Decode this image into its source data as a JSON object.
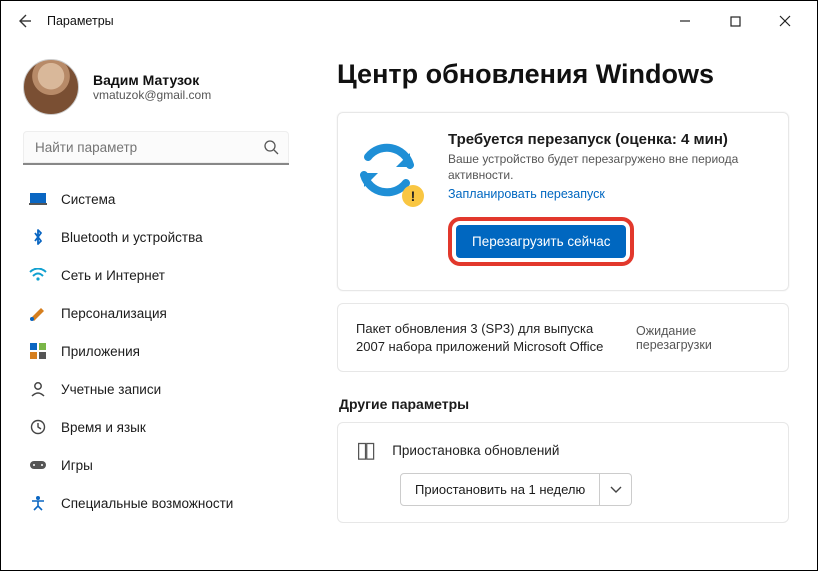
{
  "titlebar": {
    "app_title": "Параметры"
  },
  "account": {
    "name": "Вадим Матузок",
    "email": "vmatuzok@gmail.com"
  },
  "search": {
    "placeholder": "Найти параметр"
  },
  "nav": {
    "items": [
      {
        "label": "Система"
      },
      {
        "label": "Bluetooth и устройства"
      },
      {
        "label": "Сеть и Интернет"
      },
      {
        "label": "Персонализация"
      },
      {
        "label": "Приложения"
      },
      {
        "label": "Учетные записи"
      },
      {
        "label": "Время и язык"
      },
      {
        "label": "Игры"
      },
      {
        "label": "Специальные возможности"
      }
    ]
  },
  "page": {
    "title": "Центр обновления Windows",
    "restart": {
      "heading": "Требуется перезапуск (оценка: 4 мин)",
      "subtitle": "Ваше устройство будет перезагружено вне периода активности.",
      "schedule_link": "Запланировать перезапуск",
      "button": "Перезагрузить сейчас"
    },
    "update_item": {
      "name": "Пакет обновления 3 (SP3) для выпуска 2007 набора приложений Microsoft Office",
      "status": "Ожидание перезагрузки"
    },
    "other_section": "Другие параметры",
    "pause": {
      "label": "Приостановка обновлений",
      "select": "Приостановить на 1 неделю"
    }
  }
}
